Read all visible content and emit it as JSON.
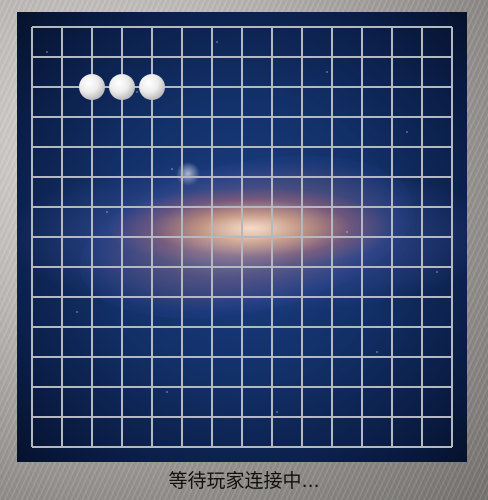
{
  "board": {
    "lines": 15,
    "line_color": "#b4b8c0",
    "stones": [
      {
        "col": 2,
        "row": 2,
        "color": "white"
      },
      {
        "col": 3,
        "row": 2,
        "color": "white"
      },
      {
        "col": 4,
        "row": 2,
        "color": "white"
      }
    ]
  },
  "status": {
    "text": "等待玩家连接中..."
  }
}
